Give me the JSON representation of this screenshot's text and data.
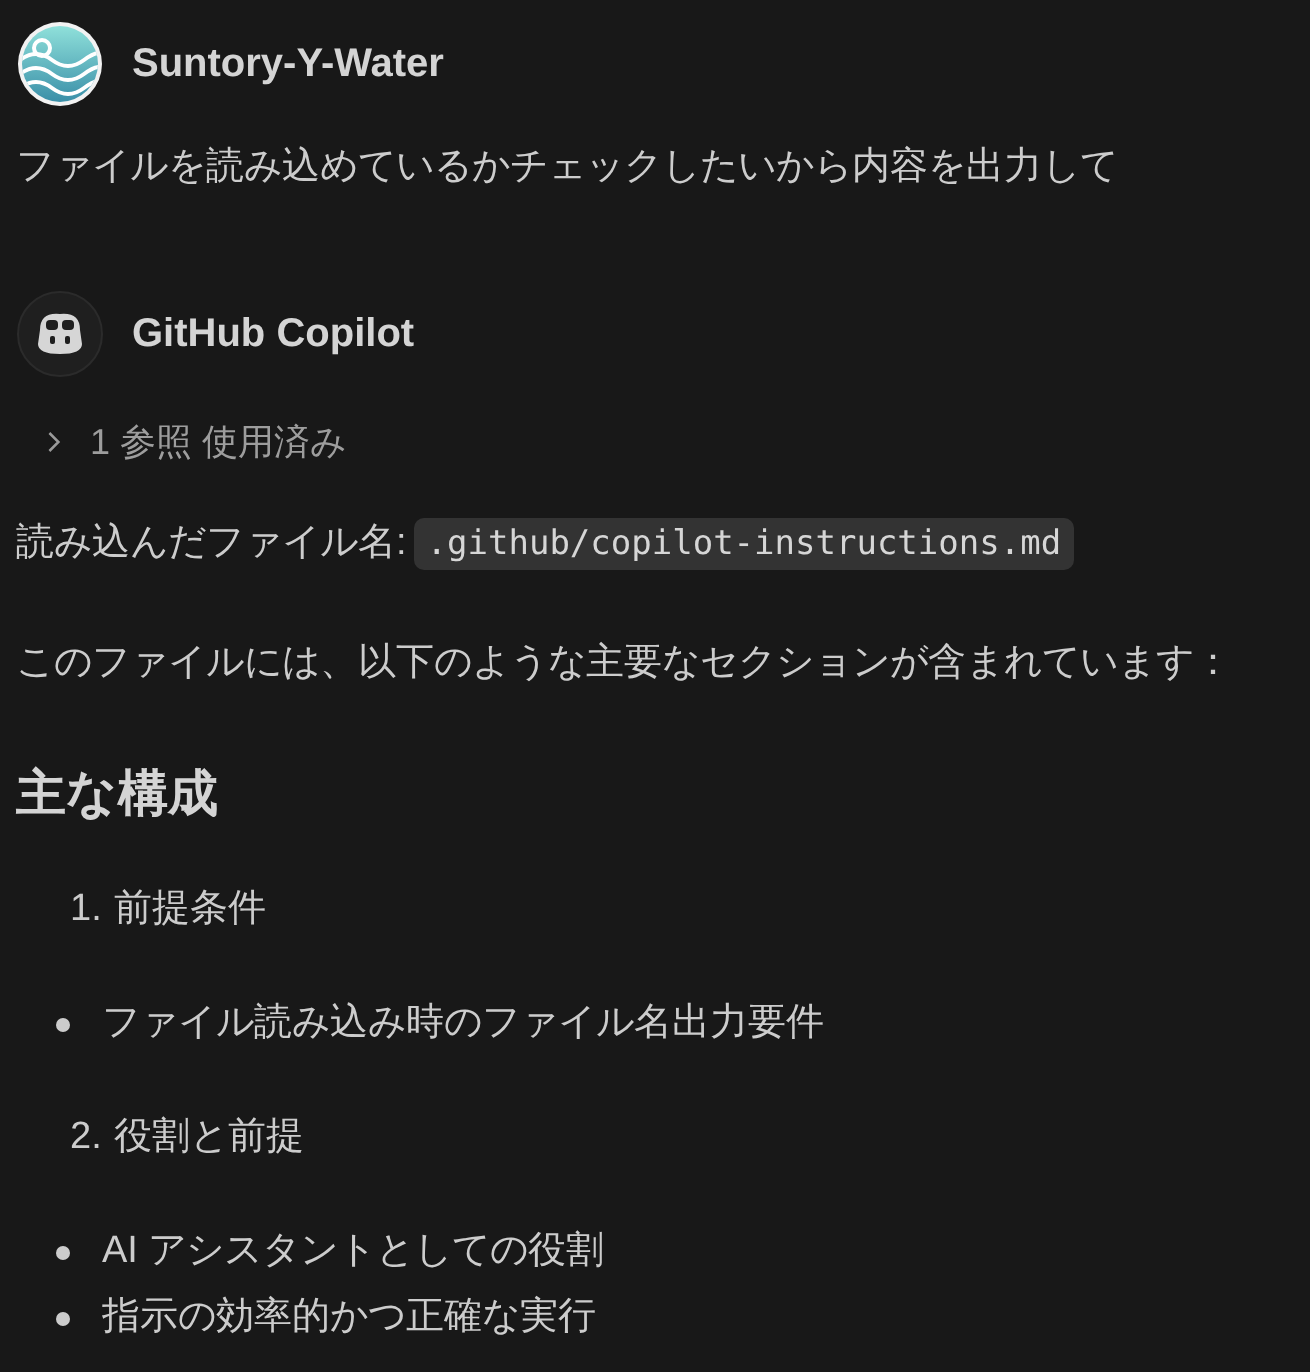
{
  "messages": [
    {
      "author": "Suntory-Y-Water",
      "kind": "user",
      "text": "ファイルを読み込めているかチェックしたいから内容を出力して"
    },
    {
      "author": "GitHub Copilot",
      "kind": "assistant",
      "references": {
        "label": "1 参照 使用済み",
        "expanded": false
      },
      "blocks": [
        {
          "kind": "file",
          "label": "読み込んだファイル名:",
          "code": ".github/copilot-instructions.md"
        },
        {
          "kind": "paragraph",
          "text": "このファイルには、以下のような主要なセクションが含まれています："
        },
        {
          "kind": "heading",
          "text": "主な構成"
        },
        {
          "kind": "ordered",
          "number": "1.",
          "text": "前提条件"
        },
        {
          "kind": "bullets",
          "items": [
            "ファイル読み込み時のファイル名出力要件"
          ]
        },
        {
          "kind": "ordered",
          "number": "2.",
          "text": "役割と前提"
        },
        {
          "kind": "bullets",
          "items": [
            "AI アシスタントとしての役割",
            "指示の効率的かつ正確な実行"
          ]
        }
      ]
    }
  ]
}
